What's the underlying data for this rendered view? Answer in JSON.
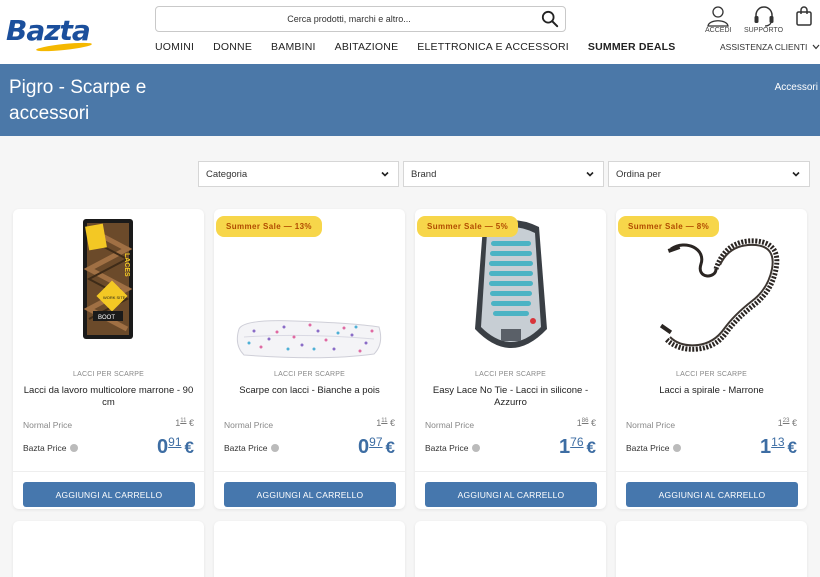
{
  "header": {
    "logo": "Bazta",
    "search_placeholder": "Cerca prodotti, marchi e altro...",
    "nav": [
      "UOMINI",
      "DONNE",
      "BAMBINI",
      "ABITAZIONE",
      "ELETTRONICA E ACCESSORI",
      "SUMMER DEALS"
    ],
    "account_label": "ACCEDI",
    "support_label": "SUPPORTO",
    "assistance_label": "ASSISTENZA CLIENTI"
  },
  "banner": {
    "title": "Pigro - Scarpe e accessori",
    "breadcrumb": "Accessori"
  },
  "filters": {
    "category": "Categoria",
    "brand": "Brand",
    "sort": "Ordina per"
  },
  "labels": {
    "normal_price": "Normal Price",
    "bazta_price": "Bazta Price",
    "currency": "€",
    "add_to_cart": "AGGIUNGI AL CARRELLO"
  },
  "products": [
    {
      "badge": "",
      "category": "LACCI PER SCARPE",
      "name": "Lacci da lavoro multicolore marrone - 90 cm",
      "normal_int": "1",
      "normal_dec": "11",
      "bazta_int": "0",
      "bazta_dec": "91",
      "package_text": "LACES",
      "package_sub": "BOOT",
      "package_tag": "WORK SITE"
    },
    {
      "badge": "Summer Sale — 13%",
      "category": "LACCI PER SCARPE",
      "name": "Scarpe con lacci - Bianche a pois",
      "normal_int": "1",
      "normal_dec": "11",
      "bazta_int": "0",
      "bazta_dec": "97"
    },
    {
      "badge": "Summer Sale — 5%",
      "category": "LACCI PER SCARPE",
      "name": "Easy Lace No Tie - Lacci in silicone - Azzurro",
      "normal_int": "1",
      "normal_dec": "86",
      "bazta_int": "1",
      "bazta_dec": "76"
    },
    {
      "badge": "Summer Sale — 8%",
      "category": "LACCI PER SCARPE",
      "name": "Lacci a spirale - Marrone",
      "normal_int": "1",
      "normal_dec": "23",
      "bazta_int": "1",
      "bazta_dec": "13"
    }
  ],
  "colors": {
    "brand_blue": "#4b78a8",
    "button_blue": "#4677ad",
    "price_blue": "#3d6da3",
    "badge_yellow": "#f7d64a",
    "logo_blue": "#1b4f9c"
  }
}
